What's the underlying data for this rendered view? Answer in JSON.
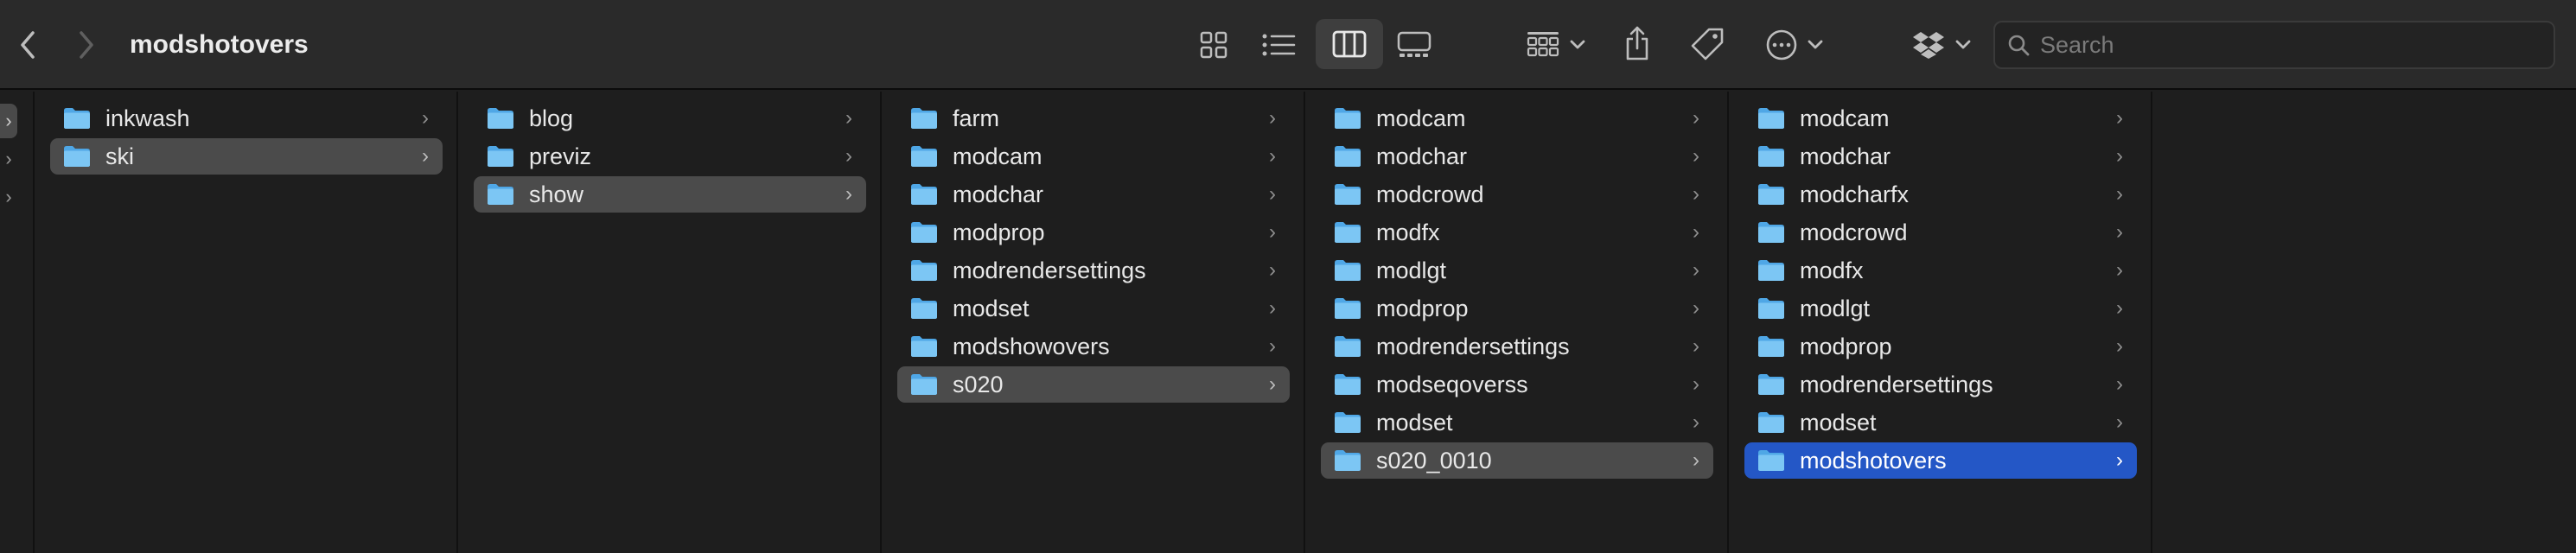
{
  "window": {
    "title": "modshotovers"
  },
  "toolbar": {
    "back_icon": "chevron-left-icon",
    "forward_icon": "chevron-right-icon",
    "view_modes": [
      "icons",
      "list",
      "columns",
      "gallery"
    ],
    "active_view": "columns",
    "group_icon": "group-grid-icon",
    "share_icon": "share-icon",
    "tag_icon": "tag-icon",
    "action_icon": "ellipsis-circle-icon",
    "dropbox_icon": "dropbox-icon"
  },
  "search": {
    "placeholder": "Search",
    "value": ""
  },
  "columns": [
    {
      "items": [
        {
          "name": "inkwash",
          "selected": false
        },
        {
          "name": "ski",
          "selected": true
        }
      ]
    },
    {
      "items": [
        {
          "name": "blog",
          "selected": false
        },
        {
          "name": "previz",
          "selected": false
        },
        {
          "name": "show",
          "selected": true
        }
      ]
    },
    {
      "items": [
        {
          "name": "farm",
          "selected": false
        },
        {
          "name": "modcam",
          "selected": false
        },
        {
          "name": "modchar",
          "selected": false
        },
        {
          "name": "modprop",
          "selected": false
        },
        {
          "name": "modrendersettings",
          "selected": false
        },
        {
          "name": "modset",
          "selected": false
        },
        {
          "name": "modshowovers",
          "selected": false
        },
        {
          "name": "s020",
          "selected": true
        }
      ]
    },
    {
      "items": [
        {
          "name": "modcam",
          "selected": false
        },
        {
          "name": "modchar",
          "selected": false
        },
        {
          "name": "modcrowd",
          "selected": false
        },
        {
          "name": "modfx",
          "selected": false
        },
        {
          "name": "modlgt",
          "selected": false
        },
        {
          "name": "modprop",
          "selected": false
        },
        {
          "name": "modrendersettings",
          "selected": false
        },
        {
          "name": "modseqoverss",
          "selected": false
        },
        {
          "name": "modset",
          "selected": false
        },
        {
          "name": "s020_0010",
          "selected": true
        }
      ]
    },
    {
      "items": [
        {
          "name": "modcam",
          "selected": false
        },
        {
          "name": "modchar",
          "selected": false
        },
        {
          "name": "modcharfx",
          "selected": false
        },
        {
          "name": "modcrowd",
          "selected": false
        },
        {
          "name": "modfx",
          "selected": false
        },
        {
          "name": "modlgt",
          "selected": false
        },
        {
          "name": "modprop",
          "selected": false
        },
        {
          "name": "modrendersettings",
          "selected": false
        },
        {
          "name": "modset",
          "selected": false
        },
        {
          "name": "modshotovers",
          "selected": true,
          "active": true
        }
      ]
    }
  ],
  "colors": {
    "background": "#1e1e1e",
    "toolbar": "#2a2a2a",
    "selection_inactive": "#4b4b4b",
    "selection_active": "#2457c6",
    "folder_light": "#7cc6f4",
    "folder_dark": "#4fa7e6"
  }
}
